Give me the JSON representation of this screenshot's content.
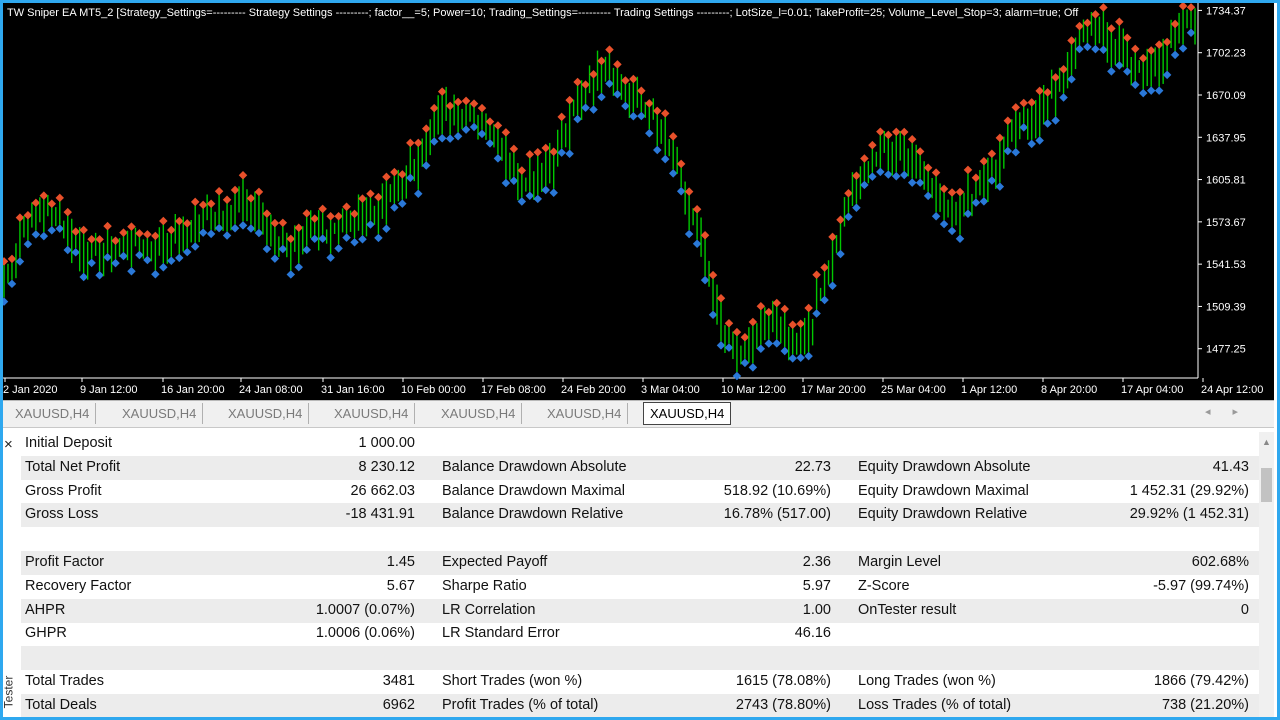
{
  "chart": {
    "title": "TW Sniper EA MT5_2 [Strategy_Settings=--------- Strategy Settings ---------; factor__=5; Power=10; Trading_Settings=--------- Trading Settings ---------; LotSize_l=0.01; TakeProfit=25; Volume_Level_Stop=3; alarm=true; Off",
    "price_ticks": [
      "1734.37",
      "1702.23",
      "1670.09",
      "1637.95",
      "1605.81",
      "1573.67",
      "1541.53",
      "1509.39",
      "1477.25"
    ],
    "price_range": [
      1455,
      1740
    ],
    "date_ticks": [
      "2 Jan 2020",
      "9 Jan 12:00",
      "16 Jan 20:00",
      "24 Jan 08:00",
      "31 Jan 16:00",
      "10 Feb 00:00",
      "17 Feb 08:00",
      "24 Feb 20:00",
      "3 Mar 04:00",
      "10 Mar 12:00",
      "17 Mar 20:00",
      "25 Mar 04:00",
      "1 Apr 12:00",
      "8 Apr 20:00",
      "17 Apr 04:00",
      "24 Apr 12:00"
    ],
    "series_keypoints": [
      1525,
      1565,
      1582,
      1578,
      1555,
      1548,
      1553,
      1560,
      1555,
      1558,
      1565,
      1578,
      1582,
      1585,
      1578,
      1560,
      1555,
      1566,
      1570,
      1575,
      1578,
      1590,
      1606,
      1630,
      1660,
      1655,
      1650,
      1640,
      1605,
      1610,
      1620,
      1652,
      1680,
      1692,
      1672,
      1660,
      1640,
      1600,
      1560,
      1505,
      1470,
      1482,
      1500,
      1478,
      1495,
      1535,
      1585,
      1610,
      1632,
      1628,
      1618,
      1590,
      1582,
      1598,
      1612,
      1640,
      1655,
      1662,
      1690,
      1722,
      1712,
      1704,
      1688,
      1694,
      1715,
      1728
    ],
    "colors": {
      "up": "#00c800",
      "sell_marker": "#e8502a",
      "buy_marker": "#2a78d8"
    }
  },
  "tabs": [
    "XAUUSD,H4",
    "XAUUSD,H4",
    "XAUUSD,H4",
    "XAUUSD,H4",
    "XAUUSD,H4",
    "XAUUSD,H4",
    "XAUUSD,H4"
  ],
  "report": {
    "rows": [
      {
        "c1": [
          "Initial Deposit",
          "1 000.00"
        ],
        "c2": [
          "",
          ""
        ],
        "c3": [
          "",
          ""
        ]
      },
      {
        "c1": [
          "Total Net Profit",
          "8 230.12"
        ],
        "c2": [
          "Balance Drawdown Absolute",
          "22.73"
        ],
        "c3": [
          "Equity Drawdown Absolute",
          "41.43"
        ]
      },
      {
        "c1": [
          "Gross Profit",
          "26 662.03"
        ],
        "c2": [
          "Balance Drawdown Maximal",
          "518.92 (10.69%)"
        ],
        "c3": [
          "Equity Drawdown Maximal",
          "1 452.31 (29.92%)"
        ]
      },
      {
        "c1": [
          "Gross Loss",
          "-18 431.91"
        ],
        "c2": [
          "Balance Drawdown Relative",
          "16.78% (517.00)"
        ],
        "c3": [
          "Equity Drawdown Relative",
          "29.92% (1 452.31)"
        ]
      },
      {
        "c1": [
          "",
          ""
        ],
        "c2": [
          "",
          ""
        ],
        "c3": [
          "",
          ""
        ]
      },
      {
        "c1": [
          "Profit Factor",
          "1.45"
        ],
        "c2": [
          "Expected Payoff",
          "2.36"
        ],
        "c3": [
          "Margin Level",
          "602.68%"
        ]
      },
      {
        "c1": [
          "Recovery Factor",
          "5.67"
        ],
        "c2": [
          "Sharpe Ratio",
          "5.97"
        ],
        "c3": [
          "Z-Score",
          "-5.97 (99.74%)"
        ]
      },
      {
        "c1": [
          "AHPR",
          "1.0007 (0.07%)"
        ],
        "c2": [
          "LR Correlation",
          "1.00"
        ],
        "c3": [
          "OnTester result",
          "0"
        ]
      },
      {
        "c1": [
          "GHPR",
          "1.0006 (0.06%)"
        ],
        "c2": [
          "LR Standard Error",
          "46.16"
        ],
        "c3": [
          "",
          ""
        ]
      },
      {
        "c1": [
          "",
          ""
        ],
        "c2": [
          "",
          ""
        ],
        "c3": [
          "",
          ""
        ]
      },
      {
        "c1": [
          "Total Trades",
          "3481"
        ],
        "c2": [
          "Short Trades (won %)",
          "1615 (78.08%)"
        ],
        "c3": [
          "Long Trades (won %)",
          "1866 (79.42%)"
        ]
      },
      {
        "c1": [
          "Total Deals",
          "6962"
        ],
        "c2": [
          "Profit Trades (% of total)",
          "2743 (78.80%)"
        ],
        "c3": [
          "Loss Trades (% of total)",
          "738 (21.20%)"
        ]
      }
    ]
  },
  "panel": {
    "close_glyph": "×",
    "side_label": "Tester"
  }
}
